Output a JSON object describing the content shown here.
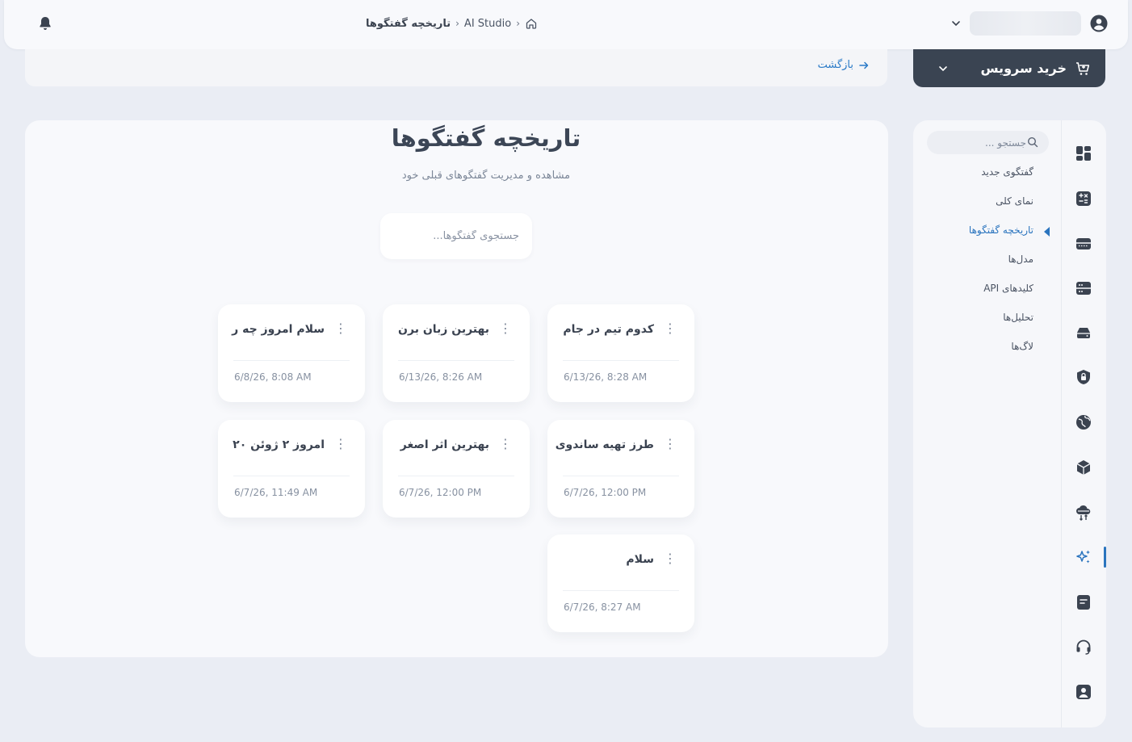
{
  "header": {
    "breadcrumb": {
      "home_icon": "home-icon",
      "section": "AI Studio",
      "current": "تاریخچه گفتگوها"
    },
    "notifications_icon": "bell-icon",
    "user_icon": "user-circle-icon",
    "user_menu_icon": "chevron-down-icon"
  },
  "subbar": {
    "back_label": "بازگشت",
    "back_icon": "arrow-right-icon"
  },
  "buy_service": {
    "label": "خرید سرویس",
    "icon": "cart-icon"
  },
  "main": {
    "title": "تاریخچه گفتگوها",
    "subtitle": "مشاهده و مدیریت گفتگوهای قبلی خود",
    "search_placeholder": "جستجوی گفتگوها...",
    "search_value": "",
    "conversations": [
      {
        "title": "کدوم تیم در جام",
        "date": "6/13/26, 8:28 AM"
      },
      {
        "title": "بهترین زبان برن",
        "date": "6/13/26, 8:26 AM"
      },
      {
        "title": "سلام امروز چه ر",
        "date": "6/8/26, 8:08 AM"
      },
      {
        "title": "طرز تهیه ساندوی",
        "date": "6/7/26, 12:00 PM"
      },
      {
        "title": "بهترین اثر اصغر",
        "date": "6/7/26, 12:00 PM"
      },
      {
        "title": "امروز ۲ ژوئن ۲۰",
        "date": "6/7/26, 11:49 AM"
      },
      {
        "title": "سلام",
        "date": "6/7/26, 8:27 AM"
      }
    ]
  },
  "sidebar": {
    "search_placeholder": "جستجو ...",
    "items": [
      {
        "label": "گفتگوی جدید",
        "active": false
      },
      {
        "label": "نمای کلی",
        "active": false
      },
      {
        "label": "تاریخچه گفتگوها",
        "active": true
      },
      {
        "label": "مدل‌ها",
        "active": false
      },
      {
        "label": "کلیدهای API",
        "active": false
      },
      {
        "label": "تحلیل‌ها",
        "active": false
      },
      {
        "label": "لاگ‌ها",
        "active": false
      }
    ],
    "rail_icons": [
      "dashboard-icon",
      "calculator-icon",
      "server-icon",
      "database-icon",
      "cloud-drive-icon",
      "shield-icon",
      "globe-icon",
      "cube-icon",
      "cloud-transfer-icon",
      "sparkle-ai-icon",
      "document-icon",
      "headset-icon",
      "contact-icon"
    ],
    "accent_color": "#2a74be"
  }
}
